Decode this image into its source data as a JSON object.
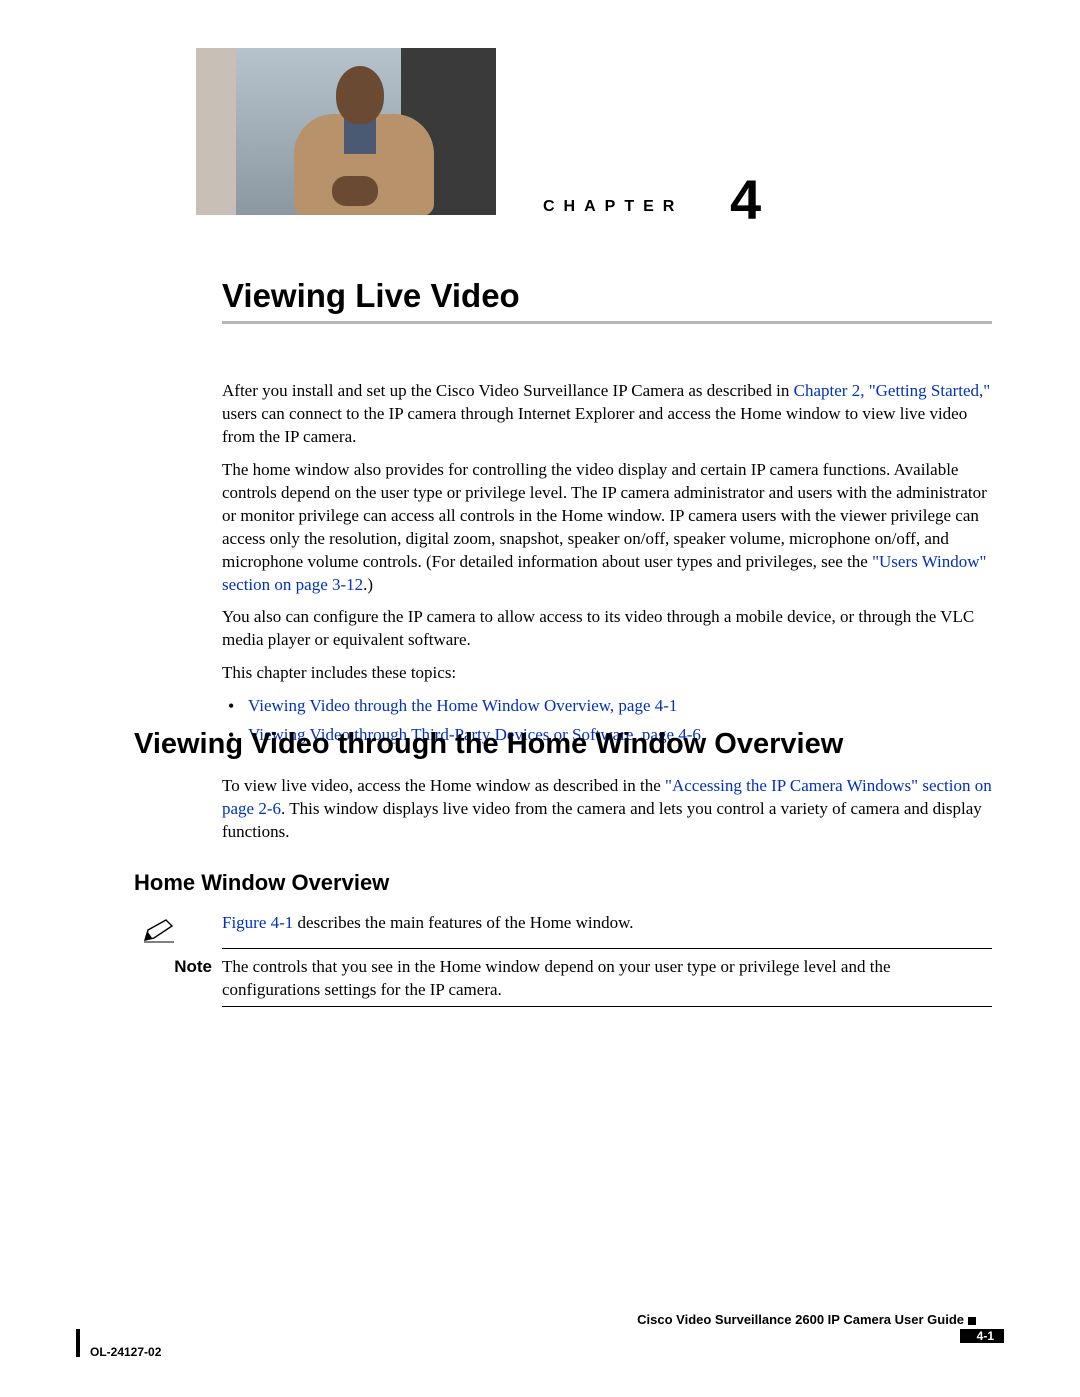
{
  "chapter": {
    "label": "CHAPTER",
    "number": "4",
    "title": "Viewing Live Video"
  },
  "intro": {
    "p1_a": "After you install and set up the Cisco Video Surveillance IP Camera as described in ",
    "p1_link": "Chapter 2, \"Getting Started,\"",
    "p1_b": " users can connect to the IP camera through Internet Explorer and access the Home window to view live video from the IP camera.",
    "p2_a": "The home window also provides for controlling the video display and certain IP camera functions. Available controls depend on the user type or privilege level. The IP camera administrator and users with the administrator or monitor privilege can access all controls in the Home window. IP camera users with the viewer privilege can access only the resolution, digital zoom, snapshot, speaker on/off, speaker volume, microphone on/off, and microphone volume controls. (For detailed information about user types and privileges, see the ",
    "p2_link": "\"Users Window\" section on page 3-12",
    "p2_b": ".)",
    "p3": "You also can configure the IP camera to allow access to its video through a mobile device, or through the VLC media player or equivalent software.",
    "topics_lead": "This chapter includes these topics:",
    "topics": [
      "Viewing Video through the Home Window Overview, page 4-1",
      "Viewing Video through Third-Party Devices or Software, page 4-6"
    ]
  },
  "section1": {
    "heading": "Viewing Video through the Home Window Overview",
    "p1_a": "To view live video, access the Home window as described in the ",
    "p1_link": "\"Accessing the IP Camera Windows\" section on page 2-6",
    "p1_b": ". This window displays live video from the camera and lets you control a variety of camera and display functions."
  },
  "subsection": {
    "heading": "Home Window Overview",
    "p1_link": "Figure 4-1",
    "p1_rest": " describes the main features of the Home window."
  },
  "note": {
    "label": "Note",
    "text": "The controls that you see in the Home window depend on your user type or privilege level and the configurations settings for the IP camera."
  },
  "footer": {
    "guide_title": "Cisco Video Surveillance 2600 IP Camera User Guide",
    "page_number": "4-1",
    "doc_id": "OL-24127-02"
  }
}
